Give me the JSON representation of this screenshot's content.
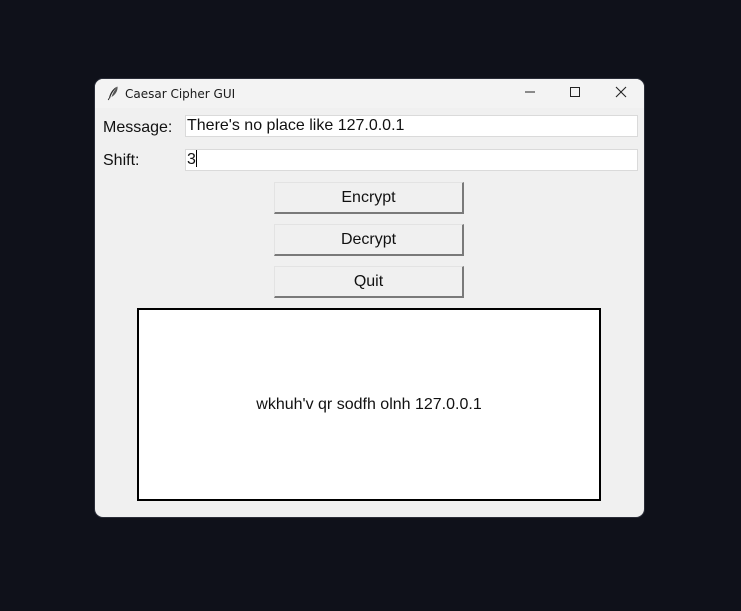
{
  "window": {
    "title": "Caesar Cipher GUI"
  },
  "titlebar": {
    "icons": [
      "feather-icon",
      "minimize-icon",
      "maximize-icon",
      "close-icon"
    ]
  },
  "form": {
    "message_label": "Message:",
    "message_value": "There's no place like 127.0.0.1",
    "shift_label": "Shift:",
    "shift_value": "3"
  },
  "buttons": {
    "encrypt_label": "Encrypt",
    "decrypt_label": "Decrypt",
    "quit_label": "Quit"
  },
  "output": {
    "text": "wkhuh'v qr sodfh olnh 127.0.0.1"
  },
  "colors": {
    "desktop": "#0f111a",
    "window_bg": "#f0f0f0",
    "output_border": "#000000"
  }
}
